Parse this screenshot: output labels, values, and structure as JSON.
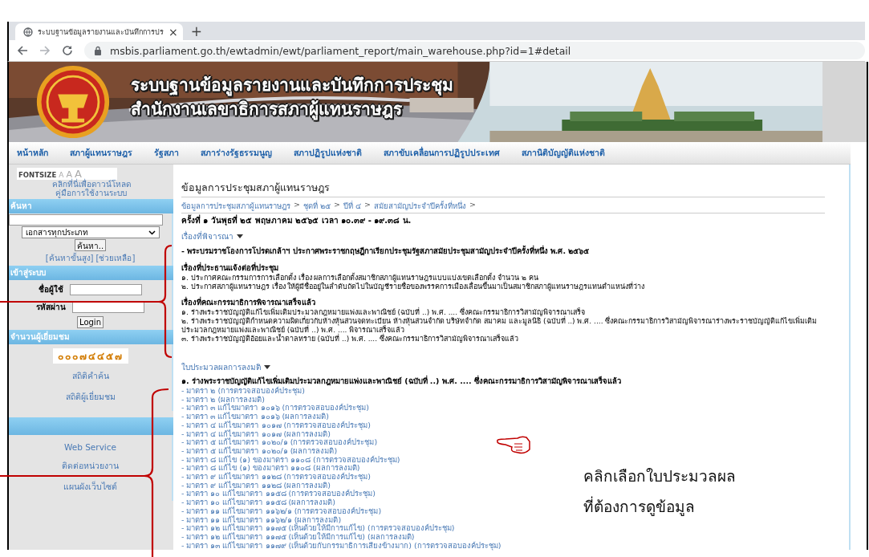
{
  "browser": {
    "tab_title": "ระบบฐานข้อมูลรายงานและบันทึกการปร",
    "tab_close": "×",
    "new_tab": "+",
    "url": "msbis.parliament.go.th/ewtadmin/ewt/parliament_report/main_warehouse.php?id=1#detail"
  },
  "banner": {
    "title_lines": [
      "ระบบฐานข้อมูลรายงานและบันทึกการประชุม",
      "สำนักงานเลขาธิการสภาผู้แทนราษฎร"
    ]
  },
  "nav": [
    "หน้าหลัก",
    "สภาผู้แทนราษฎร",
    "รัฐสภา",
    "สภาร่างรัฐธรรมนูญ",
    "สภาปฏิรูปแห่งชาติ",
    "สภาขับเคลื่อนการปฏิรูปประเทศ",
    "สภานิติบัญญัติแห่งชาติ"
  ],
  "sidebar": {
    "fontsize_label": "FONTSIZE",
    "fontsize_options": [
      "A",
      "A",
      "A"
    ],
    "manual_link": [
      "คลิกที่นี่เพื่อดาวน์โหลด",
      "คู่มือการใช้งานระบบ"
    ],
    "search": {
      "header": "ค้นหา",
      "type_value": "เอกสารทุกประเภท",
      "button": "ค้นหา..",
      "links": [
        "[ค้นหาขั้นสูง]",
        "[ช่วยเหลือ]"
      ]
    },
    "login": {
      "header": "เข้าสู่ระบบ",
      "username_label": "ชื่อผู้ใช้",
      "password_label": "รหัสผ่าน",
      "button": "Login"
    },
    "visitors": {
      "header": "จำนวนผู้เยี่ยมชม",
      "counter": "๐๐๐๗๔๔๕๗",
      "links": [
        "สถิติคำค้น",
        "สถิติผู้เยี่ยมชม"
      ]
    },
    "footer_links": [
      "Web Service",
      "ติดต่อหน่วยงาน",
      "แผนผังเว็บไซต์"
    ]
  },
  "main": {
    "heading": "ข้อมูลการประชุมสภาผู้แทนราษฎร",
    "breadcrumb": [
      "ข้อมูลการประชุมสภาผู้แทนราษฎร",
      "ชุดที่ ๒๕",
      "ปีที่ ๔",
      "สมัยสามัญประจำปีครั้งที่หนึ่ง"
    ],
    "breadcrumb_separator": ">",
    "meeting": "ครั้งที่ ๑ วันพุธที่ ๒๕ พฤษภาคม ๒๕๖๕ เวลา ๑๐.๓๙ - ๑๙.๓๘ น.",
    "agenda": {
      "toggle": "เรื่องที่พิจารณา",
      "expanded": true,
      "lead": "- พระบรมราชโองการโปรดเกล้าฯ ประกาศพระราชกฤษฎีกาเรียกประชุมรัฐสภาสมัยประชุมสามัญประจำปีครั้งที่หนึ่ง พ.ศ. ๒๕๖๕",
      "groups": [
        {
          "title": "เรื่องที่ประธานแจ้งต่อที่ประชุม",
          "items": [
            "๑. ประกาศคณะกรรมการการเลือกตั้ง เรื่อง ผลการเลือกตั้งสมาชิกสภาผู้แทนราษฎรแบบแบ่งเขตเลือกตั้ง จำนวน ๒ คน",
            "๒. ประกาศสภาผู้แทนราษฎร เรื่อง ให้ผู้มีชื่ออยู่ในลำดับถัดไปในบัญชีรายชื่อของพรรคการเมืองเลื่อนขึ้นมาเป็นสมาชิกสภาผู้แทนราษฎรแทนตำแหน่งที่ว่าง"
          ]
        },
        {
          "title": "เรื่องที่คณะกรรมาธิการพิจารณาเสร็จแล้ว",
          "items": [
            "๑. ร่างพระราชบัญญัติแก้ไขเพิ่มเติมประมวลกฎหมายแพ่งและพาณิชย์ (ฉบับที่ ..) พ.ศ. .... ซึ่งคณะกรรมาธิการวิสามัญพิจารณาเสร็จ",
            "๒. ร่างพระราชบัญญัติกำหนดความผิดเกี่ยวกับห้างหุ้นส่วนจดทะเบียน ห้างหุ้นส่วนจำกัด บริษัทจำกัด สมาคม และมูลนิธิ (ฉบับที่ ..) พ.ศ. .... ซึ่งคณะกรรมาธิการวิสามัญพิจารณาร่างพระราชบัญญัติแก้ไขเพิ่มเติมประมวลกฎหมายแพ่งและพาณิชย์ (ฉบับที่ ..) พ.ศ. .... พิจารณาเสร็จแล้ว",
            "๓. ร่างพระราชบัญญัติอ้อยและน้ำตาลทราย (ฉบับที่ ..) พ.ศ. .... ซึ่งคณะกรรมาธิการวิสามัญพิจารณาเสร็จแล้ว"
          ]
        }
      ]
    },
    "votes": {
      "toggle": "ใบประมวลผลการลงมติ",
      "expanded": true,
      "title": "๑. ร่างพระราชบัญญัติแก้ไขเพิ่มเติมประมวลกฎหมายแพ่งและพาณิชย์ (ฉบับที่ ..) พ.ศ. .... ซึ่งคณะกรรมาธิการวิสามัญพิจารณาเสร็จแล้ว",
      "links": [
        "- มาตรา ๒ (การตรวจสอบองค์ประชุม)",
        "- มาตรา ๒ (ผลการลงมติ)",
        "- มาตรา ๓ แก้ไขมาตรา ๑๐๑๖ (การตรวจสอบองค์ประชุม)",
        "- มาตรา ๓ แก้ไขมาตรา ๑๐๑๖ (ผลการลงมติ)",
        "- มาตรา ๔ แก้ไขมาตรา ๑๐๑๗ (การตรวจสอบองค์ประชุม)",
        "- มาตรา ๔ แก้ไขมาตรา ๑๐๑๗ (ผลการลงมติ)",
        "- มาตรา ๕ แก้ไขมาตรา ๑๐๒๐/๑ (การตรวจสอบองค์ประชุม)",
        "- มาตรา ๕ แก้ไขมาตรา ๑๐๒๐/๑ (ผลการลงมติ)",
        "- มาตรา ๘ แก้ไข (๑) ของมาตรา ๑๑๐๘ (การตรวจสอบองค์ประชุม)",
        "- มาตรา ๘ แก้ไข (๑) ของมาตรา ๑๑๐๘ (ผลการลงมติ)",
        "- มาตรา ๙ แก้ไขมาตรา ๑๑๒๘ (การตรวจสอบองค์ประชุม)",
        "- มาตรา ๙ แก้ไขมาตรา ๑๑๒๘ (ผลการลงมติ)",
        "- มาตรา ๑๐ แก้ไขมาตรา ๑๑๕๘ (การตรวจสอบองค์ประชุม)",
        "- มาตรา ๑๐ แก้ไขมาตรา ๑๑๕๘ (ผลการลงมติ)",
        "- มาตรา ๑๑ แก้ไขมาตรา ๑๑๖๒/๑ (การตรวจสอบองค์ประชุม)",
        "- มาตรา ๑๑ แก้ไขมาตรา ๑๑๖๒/๑ (ผลการลงมติ)",
        "- มาตรา ๑๒ แก้ไขมาตรา ๑๑๗๕ (เห็นด้วยให้มีการแก้ไข) (การตรวจสอบองค์ประชุม)",
        "- มาตรา ๑๒ แก้ไขมาตรา ๑๑๗๕ (เห็นด้วยให้มีการแก้ไข) (ผลการลงมติ)",
        "- มาตรา ๑๓ แก้ไขมาตรา ๑๑๗๙ (เห็นด้วยกับกรรมาธิการเสียงข้างมาก) (การตรวจสอบองค์ประชุม)"
      ]
    }
  },
  "callout": [
    "คลิกเลือกใบประมวลผล",
    "ที่ต้องการดูข้อมูล"
  ]
}
